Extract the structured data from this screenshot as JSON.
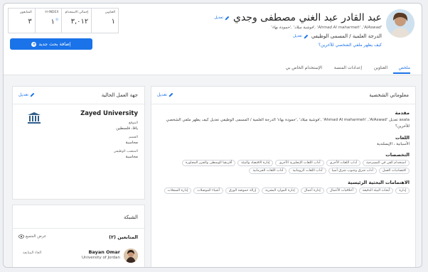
{
  "profile": {
    "name": "عبد القادر عبد الغني مصطفى وجدي",
    "edit_label": "تعديل",
    "alt_names": "'Ahmad Al maharmeh' ,'AlAswad' ,'فوشية ميلاد' ,'حمودة بهاء'",
    "degree": "الدرجة العلمية / المسمى الوظيفي",
    "degree_edit": "تعديل",
    "profile_link": "كيف يظهر ملفي الشخصي للآخرين؟"
  },
  "stats": [
    {
      "label": "العناوين",
      "value": "١",
      "badge": ""
    },
    {
      "label": "إجمالي الاستخدام",
      "value": "٣,٠١٢",
      "badge": ""
    },
    {
      "label": "H-INDEX",
      "value": "١",
      "badge": "⓪"
    },
    {
      "label": "المتابعون",
      "value": "٣",
      "badge": ""
    }
  ],
  "add_research_button": "إضافة بحث جديد",
  "tabs": [
    {
      "label": "ملخص",
      "active": true
    },
    {
      "label": "العناوين",
      "active": false
    },
    {
      "label": "إعدادات المنصة",
      "active": false
    },
    {
      "label": "الإستخدام الخاص بي",
      "active": false
    }
  ],
  "personal_info": {
    "title": "معلوماتي الشخصية",
    "edit_label": "تعديل",
    "intro_title": "مقدمة",
    "intro_text": "asala تعديل 'Ahmad Al maharmeh' ,'AlAswad' ,'فوشية ميلاد' ,'حمودة بهاء' الدرجة العلمية / المسمى الوظيفي تعديل كيف يظهر ملفي الشخصي للآخرين؟",
    "languages_title": "اللغات",
    "languages_value": "الأسبانية ، الإيسلندية",
    "specializations_title": "التخصصات",
    "specializations": [
      "استخدام الفن في المسرحية",
      "آداب اللغات الأخرى",
      "آداب اللغات الإنجليزية الأخرى",
      "إدارة الاقتصاد والبيئة",
      "أفريقيا الوسطى والجزر المجاورة",
      "اقتصاديات العمل",
      "آداب شرق وجنوب شرق آسيا",
      "آداب اللغات الرومانية",
      "آداب اللغات الجرمانية"
    ],
    "interests_title": "الاهتمامات البحثية الرئيسية",
    "interests": [
      "إدارة",
      "أبحاث البيئة الدقيقة",
      "أخلاقيات الأعمال",
      "إدارة أعمال",
      "إدارة الموارد البشرية",
      "إزالة حموضة الورق",
      "أشياء الموصلات",
      "إدارة السجلات"
    ]
  },
  "workplace": {
    "title": "جهة العمل الحالية",
    "edit_label": "تعديل",
    "university": "Zayed University",
    "location_label": "الموقع",
    "location_value": "يافا، فلسطين",
    "department_label": "القسم",
    "department_value": "محاسبة",
    "position_label": "المنصب الوظيفي",
    "position_value": "محاسبة"
  },
  "network": {
    "title": "الشبكة",
    "followers_label": "المتابعين (٢)",
    "view_all": "عرض الجميع",
    "member_name": "Bayan Omar",
    "member_affiliation": "University of Jordan",
    "member_action": "الغاء المتابعة"
  },
  "colors": {
    "accent": "#1a73e8",
    "border": "#e1e3e6",
    "background": "#f3f4f6"
  }
}
